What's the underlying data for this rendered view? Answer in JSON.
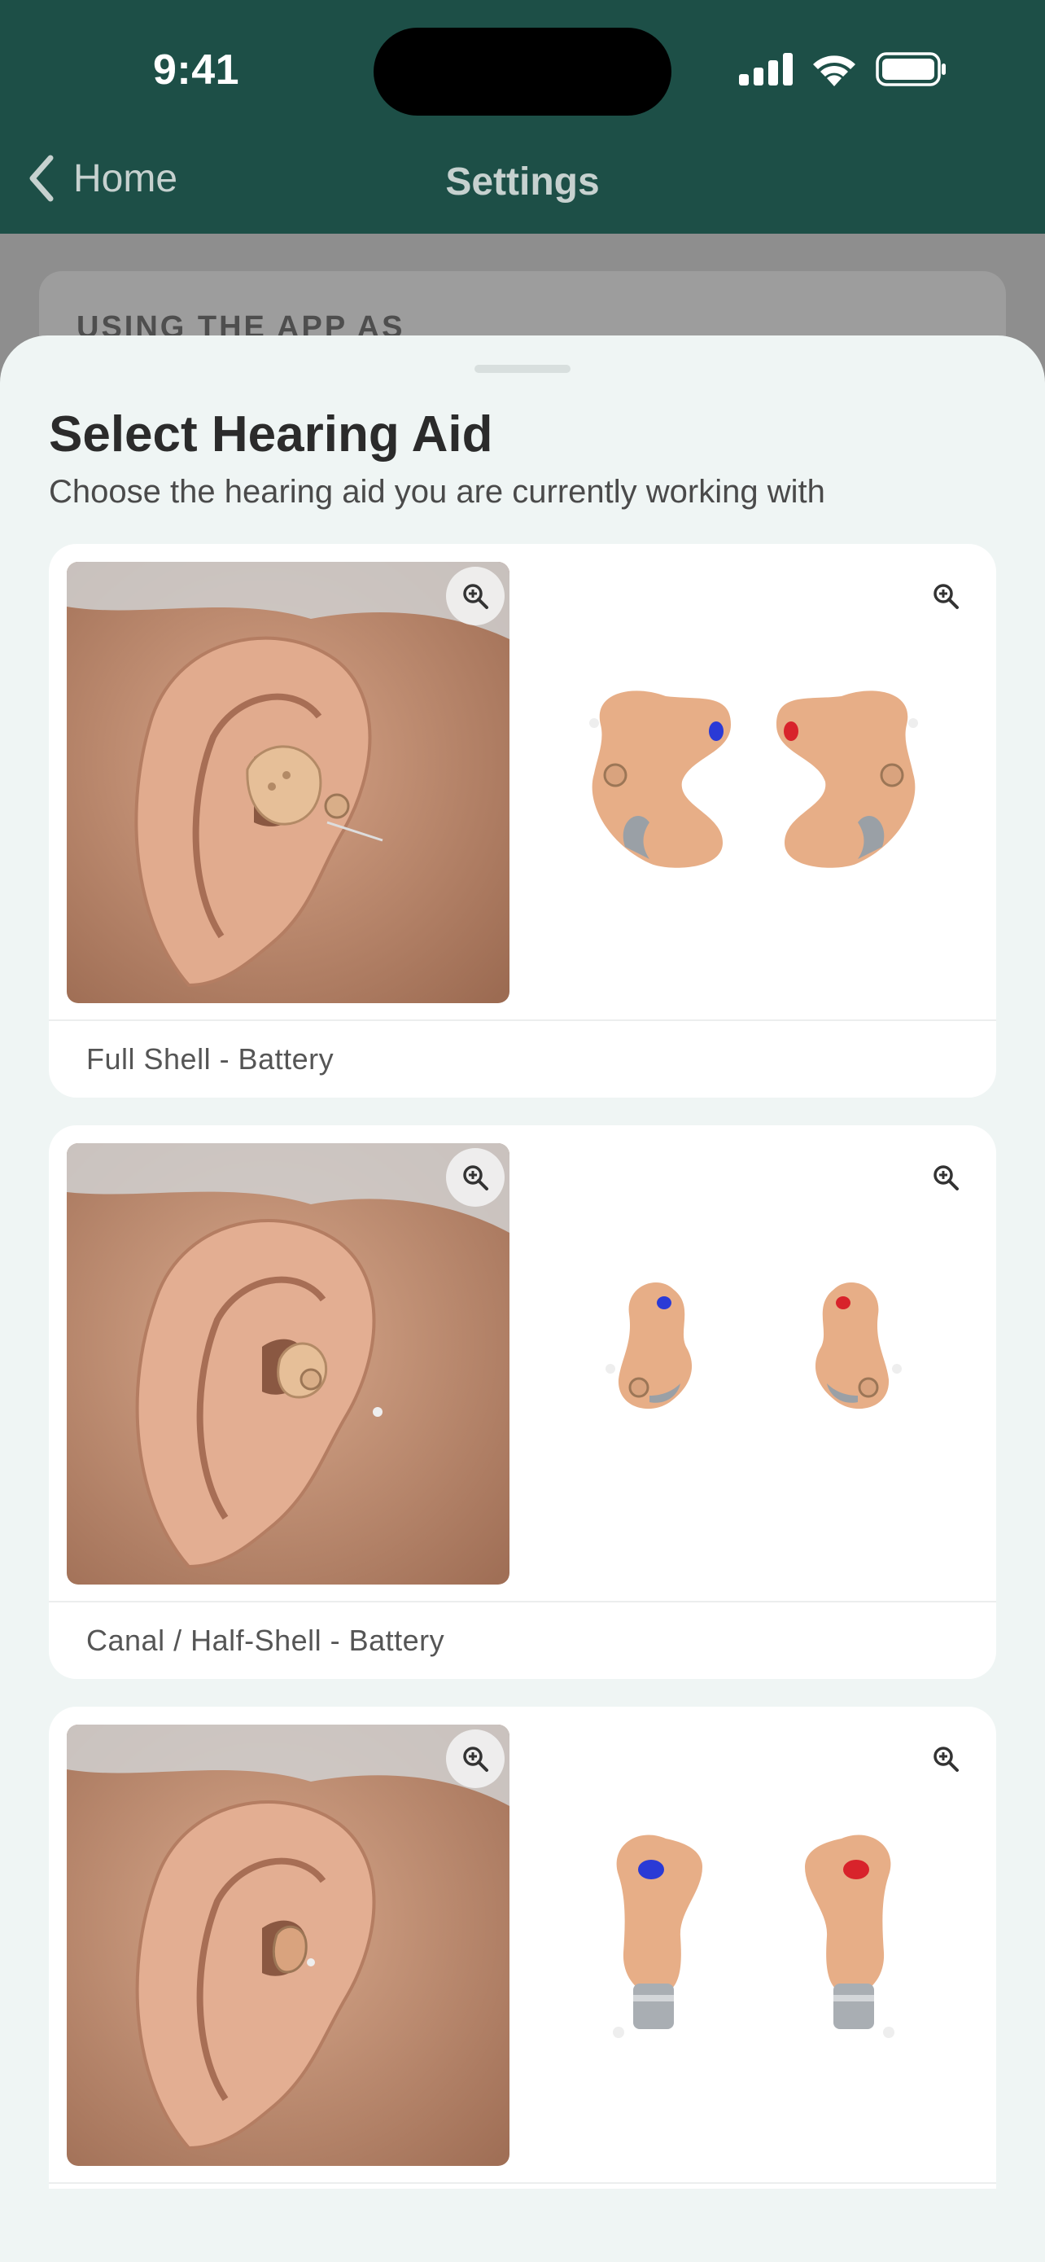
{
  "status_bar": {
    "time": "9:41"
  },
  "nav": {
    "back_label": "Home",
    "title": "Settings"
  },
  "background": {
    "section_label": "USING THE APP AS"
  },
  "sheet": {
    "title": "Select Hearing Aid",
    "subtitle": "Choose the hearing aid you are currently working with",
    "options": [
      {
        "label": "Full Shell - Battery"
      },
      {
        "label": "Canal / Half-Shell - Battery"
      },
      {
        "label": ""
      }
    ]
  },
  "colors": {
    "header": "#1d4f47",
    "sheet_bg": "#eff5f4",
    "card_bg": "#ffffff",
    "skin": "#c7906f",
    "device": "#e9b58c",
    "left_marker": "#2a3ad6",
    "right_marker": "#d8232b"
  },
  "icons": [
    "chevron-left-icon",
    "signal-icon",
    "wifi-icon",
    "battery-icon",
    "zoom-in-icon"
  ]
}
